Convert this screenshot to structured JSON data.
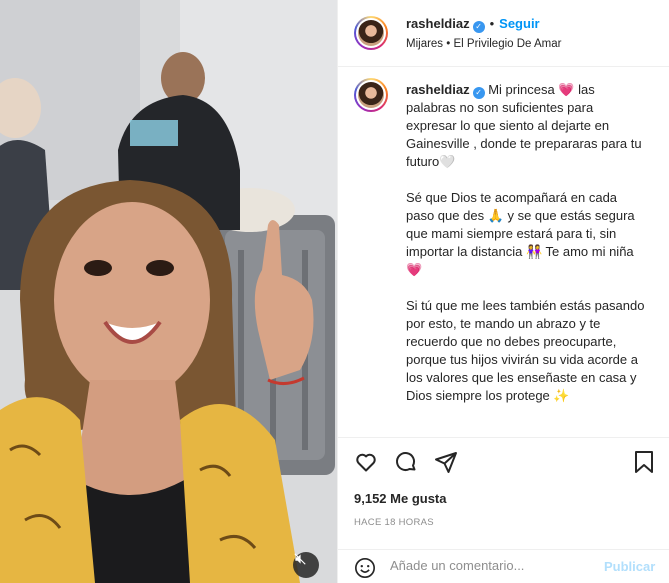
{
  "header": {
    "username": "rasheldiaz",
    "follow_label": "Seguir",
    "location": "Mijares • El Privilegio De Amar"
  },
  "caption": {
    "username": "rasheldiaz",
    "paragraphs": [
      "Mi princesa 💗 las palabras no son suficientes para expresar lo que siento al dejarte en Gainesville , donde te prepararas para tu futuro🤍",
      "Sé que Dios te acompañará en cada paso que des 🙏 y se que estás segura que mami siempre estará para ti, sin importar la distancia 👭 Te amo mi niña 💗",
      "Si tú que me lees también estás pasando por esto, te mando un abrazo y te recuerdo que no debes preocuparte, porque tus hijos vivirán su vida acorde a los valores que les enseñaste en casa y Dios siempre los protege ✨"
    ]
  },
  "engagement": {
    "likes": "9,152 Me gusta",
    "time": "HACE 18 HORAS"
  },
  "comment": {
    "placeholder": "Añade un comentario...",
    "publish_label": "Publicar"
  },
  "icons": {
    "like": "heart-icon",
    "comment": "comment-icon",
    "share": "send-icon",
    "save": "bookmark-icon",
    "emoji": "emoji-icon",
    "mute": "speaker-muted-icon",
    "verified": "verified-badge-icon"
  },
  "colors": {
    "verified": "#3897f0",
    "follow": "#0095f6",
    "publish_disabled": "#b2dffc",
    "muted_text": "#8e8e8e"
  }
}
